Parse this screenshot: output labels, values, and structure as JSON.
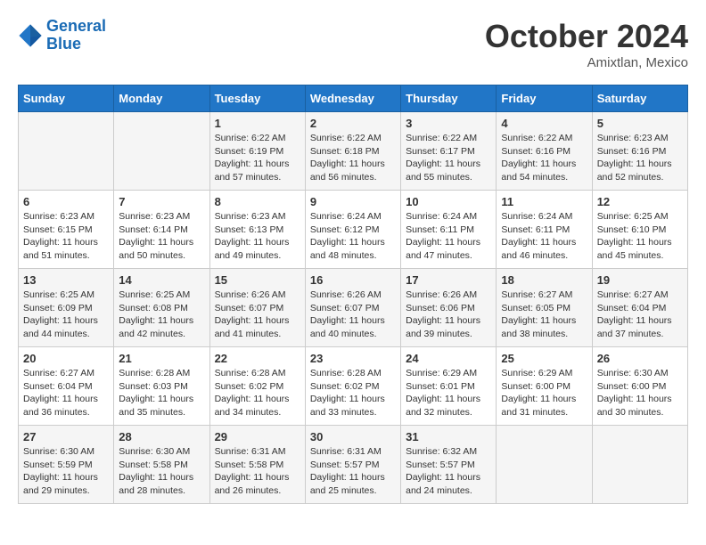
{
  "logo": {
    "line1": "General",
    "line2": "Blue"
  },
  "header": {
    "month": "October 2024",
    "location": "Amixtlan, Mexico"
  },
  "weekdays": [
    "Sunday",
    "Monday",
    "Tuesday",
    "Wednesday",
    "Thursday",
    "Friday",
    "Saturday"
  ],
  "weeks": [
    [
      {
        "day": "",
        "info": ""
      },
      {
        "day": "",
        "info": ""
      },
      {
        "day": "1",
        "sunrise": "6:22 AM",
        "sunset": "6:19 PM",
        "daylight": "11 hours and 57 minutes."
      },
      {
        "day": "2",
        "sunrise": "6:22 AM",
        "sunset": "6:18 PM",
        "daylight": "11 hours and 56 minutes."
      },
      {
        "day": "3",
        "sunrise": "6:22 AM",
        "sunset": "6:17 PM",
        "daylight": "11 hours and 55 minutes."
      },
      {
        "day": "4",
        "sunrise": "6:22 AM",
        "sunset": "6:16 PM",
        "daylight": "11 hours and 54 minutes."
      },
      {
        "day": "5",
        "sunrise": "6:23 AM",
        "sunset": "6:16 PM",
        "daylight": "11 hours and 52 minutes."
      }
    ],
    [
      {
        "day": "6",
        "sunrise": "6:23 AM",
        "sunset": "6:15 PM",
        "daylight": "11 hours and 51 minutes."
      },
      {
        "day": "7",
        "sunrise": "6:23 AM",
        "sunset": "6:14 PM",
        "daylight": "11 hours and 50 minutes."
      },
      {
        "day": "8",
        "sunrise": "6:23 AM",
        "sunset": "6:13 PM",
        "daylight": "11 hours and 49 minutes."
      },
      {
        "day": "9",
        "sunrise": "6:24 AM",
        "sunset": "6:12 PM",
        "daylight": "11 hours and 48 minutes."
      },
      {
        "day": "10",
        "sunrise": "6:24 AM",
        "sunset": "6:11 PM",
        "daylight": "11 hours and 47 minutes."
      },
      {
        "day": "11",
        "sunrise": "6:24 AM",
        "sunset": "6:11 PM",
        "daylight": "11 hours and 46 minutes."
      },
      {
        "day": "12",
        "sunrise": "6:25 AM",
        "sunset": "6:10 PM",
        "daylight": "11 hours and 45 minutes."
      }
    ],
    [
      {
        "day": "13",
        "sunrise": "6:25 AM",
        "sunset": "6:09 PM",
        "daylight": "11 hours and 44 minutes."
      },
      {
        "day": "14",
        "sunrise": "6:25 AM",
        "sunset": "6:08 PM",
        "daylight": "11 hours and 42 minutes."
      },
      {
        "day": "15",
        "sunrise": "6:26 AM",
        "sunset": "6:07 PM",
        "daylight": "11 hours and 41 minutes."
      },
      {
        "day": "16",
        "sunrise": "6:26 AM",
        "sunset": "6:07 PM",
        "daylight": "11 hours and 40 minutes."
      },
      {
        "day": "17",
        "sunrise": "6:26 AM",
        "sunset": "6:06 PM",
        "daylight": "11 hours and 39 minutes."
      },
      {
        "day": "18",
        "sunrise": "6:27 AM",
        "sunset": "6:05 PM",
        "daylight": "11 hours and 38 minutes."
      },
      {
        "day": "19",
        "sunrise": "6:27 AM",
        "sunset": "6:04 PM",
        "daylight": "11 hours and 37 minutes."
      }
    ],
    [
      {
        "day": "20",
        "sunrise": "6:27 AM",
        "sunset": "6:04 PM",
        "daylight": "11 hours and 36 minutes."
      },
      {
        "day": "21",
        "sunrise": "6:28 AM",
        "sunset": "6:03 PM",
        "daylight": "11 hours and 35 minutes."
      },
      {
        "day": "22",
        "sunrise": "6:28 AM",
        "sunset": "6:02 PM",
        "daylight": "11 hours and 34 minutes."
      },
      {
        "day": "23",
        "sunrise": "6:28 AM",
        "sunset": "6:02 PM",
        "daylight": "11 hours and 33 minutes."
      },
      {
        "day": "24",
        "sunrise": "6:29 AM",
        "sunset": "6:01 PM",
        "daylight": "11 hours and 32 minutes."
      },
      {
        "day": "25",
        "sunrise": "6:29 AM",
        "sunset": "6:00 PM",
        "daylight": "11 hours and 31 minutes."
      },
      {
        "day": "26",
        "sunrise": "6:30 AM",
        "sunset": "6:00 PM",
        "daylight": "11 hours and 30 minutes."
      }
    ],
    [
      {
        "day": "27",
        "sunrise": "6:30 AM",
        "sunset": "5:59 PM",
        "daylight": "11 hours and 29 minutes."
      },
      {
        "day": "28",
        "sunrise": "6:30 AM",
        "sunset": "5:58 PM",
        "daylight": "11 hours and 28 minutes."
      },
      {
        "day": "29",
        "sunrise": "6:31 AM",
        "sunset": "5:58 PM",
        "daylight": "11 hours and 26 minutes."
      },
      {
        "day": "30",
        "sunrise": "6:31 AM",
        "sunset": "5:57 PM",
        "daylight": "11 hours and 25 minutes."
      },
      {
        "day": "31",
        "sunrise": "6:32 AM",
        "sunset": "5:57 PM",
        "daylight": "11 hours and 24 minutes."
      },
      {
        "day": "",
        "info": ""
      },
      {
        "day": "",
        "info": ""
      }
    ]
  ],
  "labels": {
    "sunrise": "Sunrise:",
    "sunset": "Sunset:",
    "daylight": "Daylight:"
  }
}
